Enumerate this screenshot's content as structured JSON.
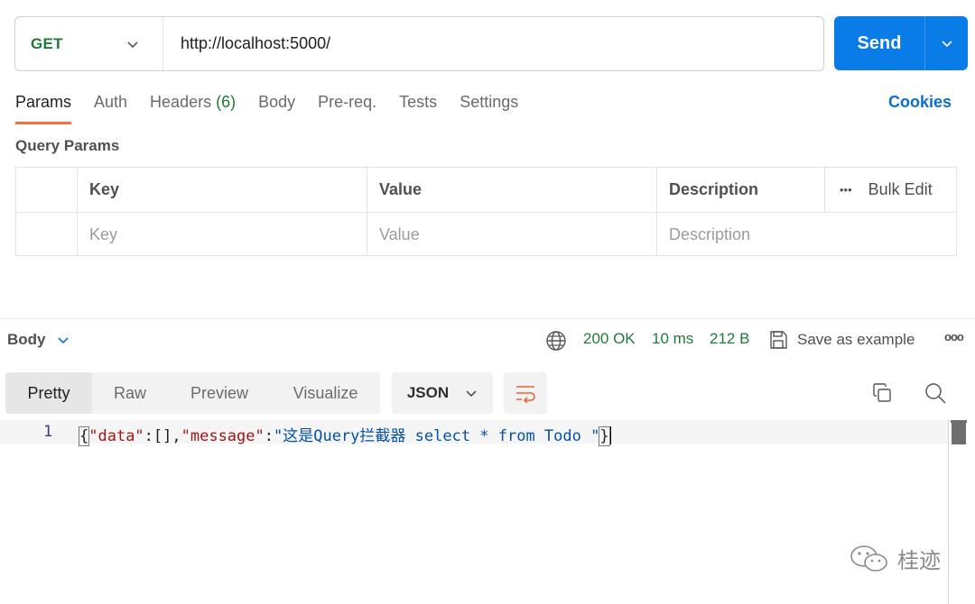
{
  "request": {
    "method": "GET",
    "url": "http://localhost:5000/",
    "send_label": "Send"
  },
  "tabs": [
    {
      "label": "Params",
      "active": true
    },
    {
      "label": "Auth"
    },
    {
      "label": "Headers",
      "count": "(6)"
    },
    {
      "label": "Body"
    },
    {
      "label": "Pre-req."
    },
    {
      "label": "Tests"
    },
    {
      "label": "Settings"
    }
  ],
  "cookies_label": "Cookies",
  "query_params": {
    "title": "Query Params",
    "headers": {
      "key": "Key",
      "value": "Value",
      "description": "Description",
      "bulk_edit": "Bulk Edit",
      "more": "•••"
    },
    "placeholders": {
      "key": "Key",
      "value": "Value",
      "description": "Description"
    }
  },
  "response": {
    "body_label": "Body",
    "status": "200 OK",
    "time": "10 ms",
    "size": "212 B",
    "save_example": "Save as example",
    "more": "ooo",
    "format_tabs": [
      "Pretty",
      "Raw",
      "Preview",
      "Visualize"
    ],
    "format": "JSON",
    "line_number": "1",
    "code": {
      "open": "{",
      "k1": "\"data\"",
      "p1": ":[],",
      "k2": "\"message\"",
      "p2": ":",
      "v2": "\"这是Query拦截器 select * from Todo \"",
      "close": "}"
    }
  },
  "watermark": "桂迹",
  "colors": {
    "accent": "#ff6c37",
    "send": "#0a7ce8",
    "ok": "#1f7a3a",
    "link": "#0a6fd1"
  }
}
